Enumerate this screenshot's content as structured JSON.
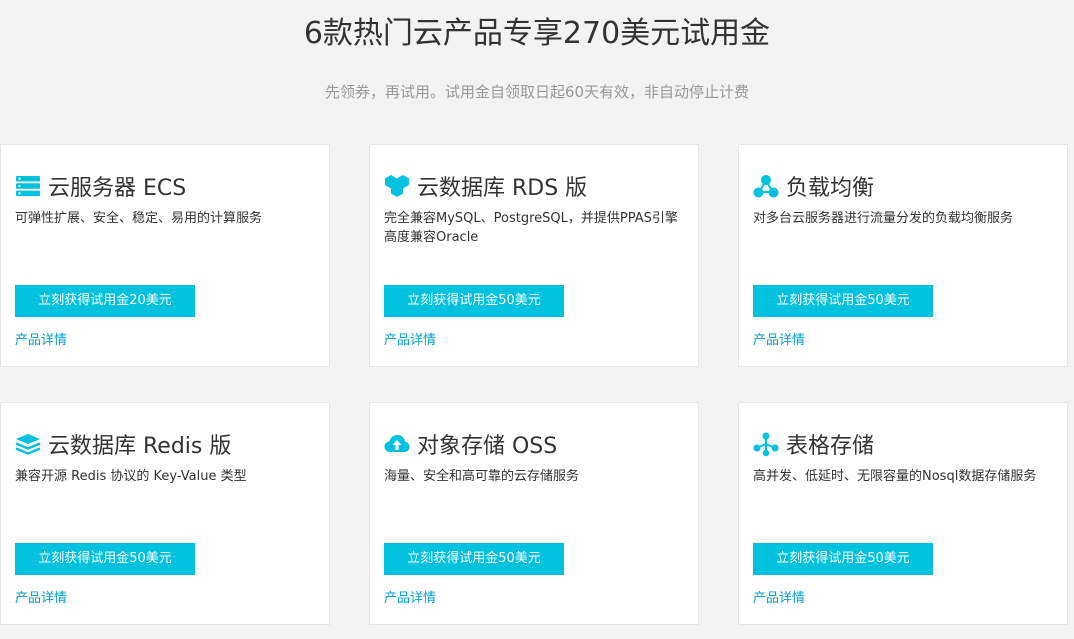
{
  "header": {
    "title": "6款热门云产品专享270美元试用金",
    "subtitle": "先领券，再试用。试用金自领取日起60天有效，非自动停止计费"
  },
  "colors": {
    "accent": "#00c1de",
    "link": "#00a2ca",
    "background": "#f3f3f3"
  },
  "products": [
    {
      "icon": "server-stack-icon",
      "name": "云服务器 ECS",
      "desc": "可弹性扩展、安全、稳定、易用的计算服务",
      "button": "立刻获得试用金20美元",
      "link": "产品详情"
    },
    {
      "icon": "database-hex-icon",
      "name": "云数据库 RDS 版",
      "desc": "完全兼容MySQL、PostgreSQL，并提供PPAS引擎高度兼容Oracle",
      "button": "立刻获得试用金50美元",
      "link": "产品详情"
    },
    {
      "icon": "load-balance-icon",
      "name": "负载均衡",
      "desc": "对多台云服务器进行流量分发的负载均衡服务",
      "button": "立刻获得试用金50美元",
      "link": "产品详情"
    },
    {
      "icon": "redis-layers-icon",
      "name": "云数据库 Redis 版",
      "desc": "兼容开源 Redis 协议的 Key-Value 类型",
      "button": "立刻获得试用金50美元",
      "link": "产品详情"
    },
    {
      "icon": "cloud-upload-icon",
      "name": "对象存储 OSS",
      "desc": "海量、安全和高可靠的云存储服务",
      "button": "立刻获得试用金50美元",
      "link": "产品详情"
    },
    {
      "icon": "table-store-icon",
      "name": "表格存储",
      "desc": "高并发、低延时、无限容量的Nosql数据存储服务",
      "button": "立刻获得试用金50美元",
      "link": "产品详情"
    }
  ]
}
